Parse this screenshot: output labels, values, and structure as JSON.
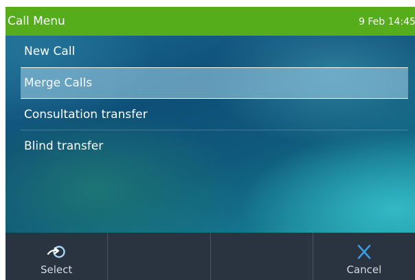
{
  "header": {
    "title": "Call Menu",
    "datetime": "9 Feb 14:45"
  },
  "menu": {
    "items": [
      {
        "label": "New Call",
        "selected": false
      },
      {
        "label": "Merge Calls",
        "selected": true
      },
      {
        "label": "Consultation transfer",
        "selected": false
      },
      {
        "label": "Blind transfer",
        "selected": false
      }
    ]
  },
  "softkeys": [
    {
      "label": "Select",
      "icon": "select-arrow-icon"
    },
    {
      "label": "",
      "icon": ""
    },
    {
      "label": "",
      "icon": ""
    },
    {
      "label": "Cancel",
      "icon": "close-icon"
    }
  ],
  "colors": {
    "header_bg": "#55ad1c",
    "softkey_bar_bg": "#2a3440",
    "cancel_icon": "#3e9de0",
    "select_icon": "#a9d6f5"
  }
}
